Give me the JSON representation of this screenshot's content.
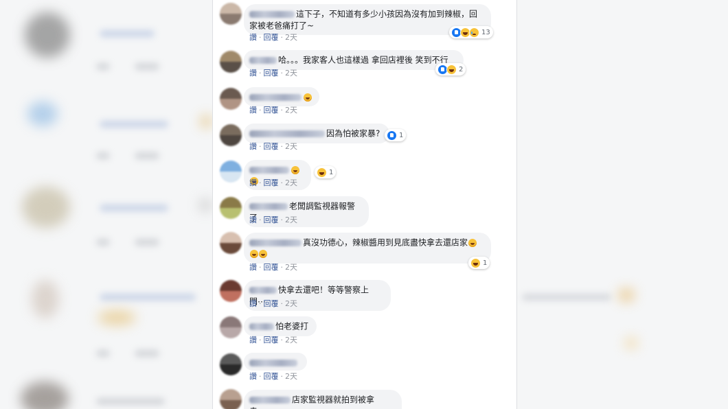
{
  "actions": {
    "like": "讚",
    "reply": "回覆",
    "time": "2天",
    "sep": "·"
  },
  "comments": [
    {
      "text_line1": "這下子，不知道有多少小孩因為沒有加到辣椒，回",
      "text_line2": "家被老爸痛打了~",
      "reactions": {
        "types": [
          "like-icon",
          "haha-icon",
          "sad-icon"
        ],
        "count": "13"
      }
    },
    {
      "text": "哈。。。我家客人也這樣過 拿回店裡後 笑到不行",
      "reactions": {
        "types": [
          "like-icon",
          "haha-icon"
        ],
        "count": "2"
      }
    },
    {
      "text": "",
      "emoji": "haha-emoji"
    },
    {
      "text": "因為怕被家暴?",
      "reactions": {
        "types": [
          "like-icon"
        ],
        "count": "1"
      }
    },
    {
      "text": "",
      "emoji": "haha-emoji-pair",
      "reactions": {
        "types": [
          "haha-icon"
        ],
        "count": "1"
      }
    },
    {
      "text": "老闆調監視器報警了"
    },
    {
      "text": "真沒功德心，辣椒醬用到見底盡快拿去還店家",
      "emoji": "haha-emoji-triple",
      "reactions": {
        "types": [
          "haha-icon"
        ],
        "count": "1"
      }
    },
    {
      "text": "快拿去還吧！等等警察上門⋯"
    },
    {
      "text": "怕老婆打"
    },
    {
      "text": ""
    },
    {
      "text": "店家監視器就拍到被拿走⋯⋯"
    }
  ],
  "colors": {
    "link": "#385898",
    "bubble": "#f2f3f5",
    "like": "#1877f2",
    "emoji": "#f7c23a"
  }
}
